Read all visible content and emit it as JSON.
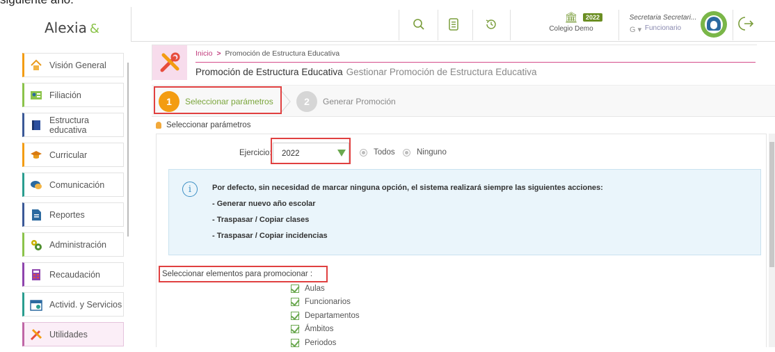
{
  "top_strip_text": "siguiente año.",
  "app": {
    "logo": "Alexia",
    "logo_mark": "&"
  },
  "sidebar": {
    "items": [
      {
        "label": "Visión General",
        "icon": "home-icon"
      },
      {
        "label": "Filiación",
        "icon": "id-card-icon"
      },
      {
        "label": "Estructura educativa",
        "icon": "book-icon"
      },
      {
        "label": "Curricular",
        "icon": "graduation-cap-icon"
      },
      {
        "label": "Comunicación",
        "icon": "chat-icon"
      },
      {
        "label": "Reportes",
        "icon": "document-icon"
      },
      {
        "label": "Administración",
        "icon": "gears-icon"
      },
      {
        "label": "Recaudación",
        "icon": "calculator-icon"
      },
      {
        "label": "Activid. y Servicios",
        "icon": "calendar-icon"
      },
      {
        "label": "Utilidades",
        "icon": "tools-icon"
      }
    ]
  },
  "header": {
    "school_name": "Colegio Demo",
    "year_badge": "2022",
    "user_name": "Secretaria Secretari...",
    "user_role": "Funcionario",
    "user_caret": "G ▾"
  },
  "breadcrumb": {
    "home": "Inicio",
    "separator": ">",
    "current": "Promoción de Estructura Educativa"
  },
  "page": {
    "title": "Promoción de Estructura Educativa",
    "subtitle": "Gestionar Promoción de Estructura Educativa"
  },
  "wizard": {
    "steps": [
      {
        "number": "1",
        "label": "Seleccionar parámetros"
      },
      {
        "number": "2",
        "label": "Generar Promoción"
      }
    ]
  },
  "section_title": "Seleccionar parámetros",
  "form": {
    "ejercicio_label": "Ejercicio:",
    "ejercicio_value": "2022",
    "radio_todos": "Todos",
    "radio_ninguno": "Ninguno"
  },
  "info": {
    "lines": [
      "Por defecto, sin necesidad de marcar ninguna opción, el sistema realizará siempre las siguientes acciones:",
      "- Generar nuevo año escolar",
      "- Traspasar / Copiar clases",
      "- Traspasar / Copiar incidencias"
    ]
  },
  "promote": {
    "label": "Seleccionar elementos para promocionar :",
    "items": [
      "Aulas",
      "Funcionarios",
      "Departamentos",
      "Ámbitos",
      "Periodos"
    ]
  },
  "colors": {
    "accent_green": "#6aa84f",
    "step_orange": "#f39c12",
    "highlight_red": "#e04040",
    "pink": "#c0397b"
  }
}
